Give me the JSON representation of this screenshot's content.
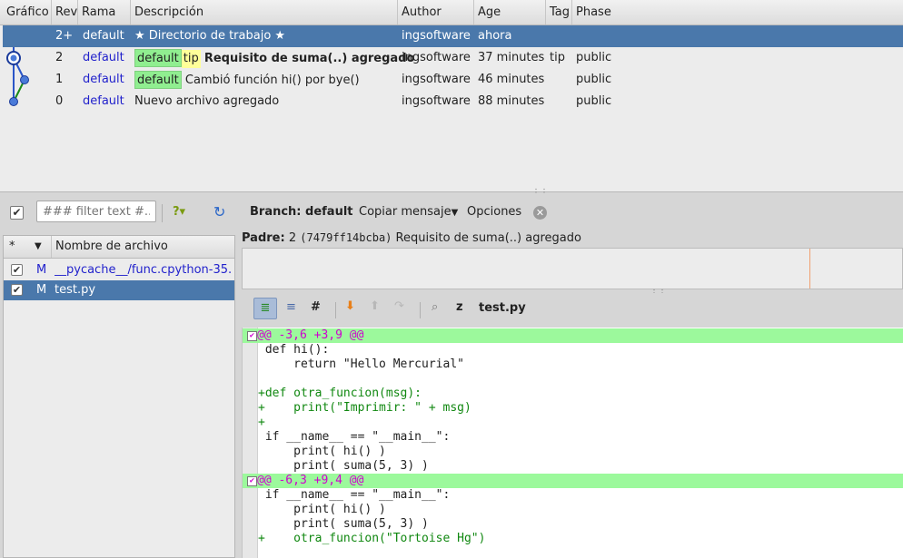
{
  "revtable": {
    "headers": [
      "Gráfico",
      "Rev",
      "Rama",
      "Descripción",
      "Author",
      "Age",
      "Tag",
      "Phase"
    ],
    "rows": [
      {
        "rev": "2+",
        "branch": "default",
        "tags": [],
        "desc": "★ Directorio de trabajo ★",
        "author": "ingsoftware",
        "age": "ahora",
        "tag": "",
        "phase": ""
      },
      {
        "rev": "2",
        "branch": "default",
        "tags": [
          {
            "text": "default",
            "kind": "branch"
          },
          {
            "text": "tip",
            "kind": "tag"
          }
        ],
        "desc": "Requisito de suma(..) agregado",
        "author": "ingsoftware",
        "age": "37 minutes",
        "tag": "tip",
        "phase": "public"
      },
      {
        "rev": "1",
        "branch": "default",
        "tags": [
          {
            "text": "default",
            "kind": "branch"
          }
        ],
        "desc": "Cambió función hi() por bye()",
        "author": "ingsoftware",
        "age": "46 minutes",
        "tag": "",
        "phase": "public"
      },
      {
        "rev": "0",
        "branch": "default",
        "tags": [],
        "desc": "Nuevo archivo agregado",
        "author": "ingsoftware",
        "age": "88 minutes",
        "tag": "",
        "phase": "public"
      }
    ]
  },
  "toolbar": {
    "filter_placeholder": "### filter text #...",
    "branch_label": "Branch: default",
    "copy_message": "Copiar mensaje",
    "options": "Opciones"
  },
  "filelist": {
    "col_star": "*",
    "col_name": "Nombre de archivo",
    "files": [
      {
        "status": "M",
        "name": "__pycache__/func.cpython-35.",
        "checked": true
      },
      {
        "status": "M",
        "name": "test.py",
        "checked": true
      }
    ]
  },
  "parent": {
    "label": "Padre:",
    "rev": "2",
    "hash": "(7479ff14bcba)",
    "desc": "Requisito de suma(..) agregado"
  },
  "diff": {
    "filename": "test.py",
    "lines": [
      {
        "type": "hunk",
        "text": "@@ -3,6 +3,9 @@"
      },
      {
        "type": "ctx",
        "text": " def hi():"
      },
      {
        "type": "ctx",
        "text": "     return \"Hello Mercurial\""
      },
      {
        "type": "ctx",
        "text": ""
      },
      {
        "type": "add",
        "text": "+def otra_funcion(msg):"
      },
      {
        "type": "add",
        "text": "+    print(\"Imprimir: \" + msg)"
      },
      {
        "type": "add",
        "text": "+"
      },
      {
        "type": "ctx",
        "text": " if __name__ == \"__main__\":"
      },
      {
        "type": "ctx",
        "text": "     print( hi() )"
      },
      {
        "type": "ctx",
        "text": "     print( suma(5, 3) )"
      },
      {
        "type": "hunk",
        "text": "@@ -6,3 +9,4 @@"
      },
      {
        "type": "ctx",
        "text": " if __name__ == \"__main__\":"
      },
      {
        "type": "ctx",
        "text": "     print( hi() )"
      },
      {
        "type": "ctx",
        "text": "     print( suma(5, 3) )"
      },
      {
        "type": "add",
        "text": "+    otra_funcion(\"Tortoise Hg\")"
      }
    ]
  },
  "colors": {
    "selection": "#4a78ab",
    "hunk_bg": "#9cf99c",
    "hunk_fg": "#d000d0",
    "add_fg": "#118811",
    "branch_tag": "#90ee90",
    "tip_tag": "#ffff99"
  }
}
